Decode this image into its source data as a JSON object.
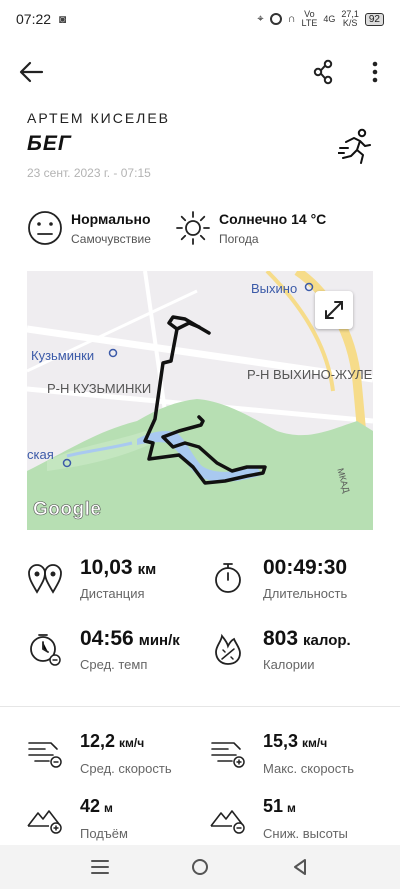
{
  "status_bar": {
    "time": "07:22",
    "network_top": "Vo",
    "network_bottom": "LTE",
    "signal": "4G",
    "speed_top": "27,1",
    "speed_bottom": "K/S",
    "battery": "92"
  },
  "header": {
    "back_icon": "arrow-left-icon",
    "share_icon": "share-icon",
    "more_icon": "more-vertical-icon"
  },
  "workout": {
    "owner": "АРТЕМ КИСЕЛЕВ",
    "activity": "БЕГ",
    "datetime": "23 сент. 2023 г. - 07:15"
  },
  "conditions": {
    "feeling_value": "Нормально",
    "feeling_label": "Самочувствие",
    "weather_value": "Солнечно 14 °C",
    "weather_label": "Погода"
  },
  "map": {
    "labels": {
      "vykhino": "Выхино",
      "kuzminki": "Кузьминки",
      "rn_kuzminki": "Р-Н КУЗЬМИНКИ",
      "rn_vykhino": "Р-Н ВЫХИНО-ЖУЛЕБ",
      "station": "ская",
      "mkad": "МКАД"
    },
    "attribution": "Google",
    "colors": {
      "park": "#b7dfb3",
      "water": "#a9c9f0",
      "route": "#111111",
      "road": "#f6dc8a"
    }
  },
  "metrics": {
    "distance": {
      "value": "10,03",
      "unit": "км",
      "label": "Дистанция"
    },
    "duration": {
      "value": "00:49:30",
      "unit": "",
      "label": "Длительность"
    },
    "pace": {
      "value": "04:56",
      "unit": "мин/к",
      "label": "Сред. темп"
    },
    "calories": {
      "value": "803",
      "unit": "калор.",
      "label": "Калории"
    },
    "avg_speed": {
      "value": "12,2",
      "unit": "км/ч",
      "label": "Сред. скорость"
    },
    "max_speed": {
      "value": "15,3",
      "unit": "км/ч",
      "label": "Макс. скорость"
    },
    "ascent": {
      "value": "42",
      "unit": "м",
      "label": "Подъём"
    },
    "descent": {
      "value": "51",
      "unit": "м",
      "label": "Сниж. высоты"
    }
  }
}
